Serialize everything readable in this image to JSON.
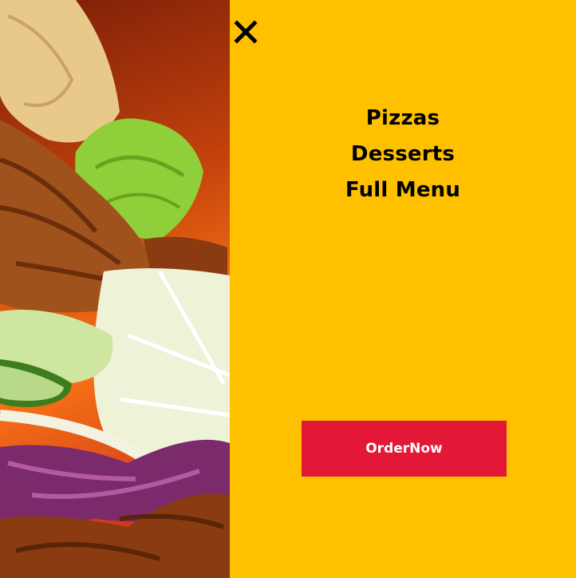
{
  "hero": {
    "image_subject": "doner-kebab-photo"
  },
  "menu": {
    "close_icon": "close-icon",
    "items": [
      {
        "label": "Pizzas"
      },
      {
        "label": "Desserts"
      },
      {
        "label": "Full Menu"
      }
    ],
    "order_button_label": "OrderNow"
  },
  "colors": {
    "panel_background": "#ffc000",
    "order_button": "#e31837",
    "nav_text": "#000000",
    "order_text": "#ffffff"
  }
}
